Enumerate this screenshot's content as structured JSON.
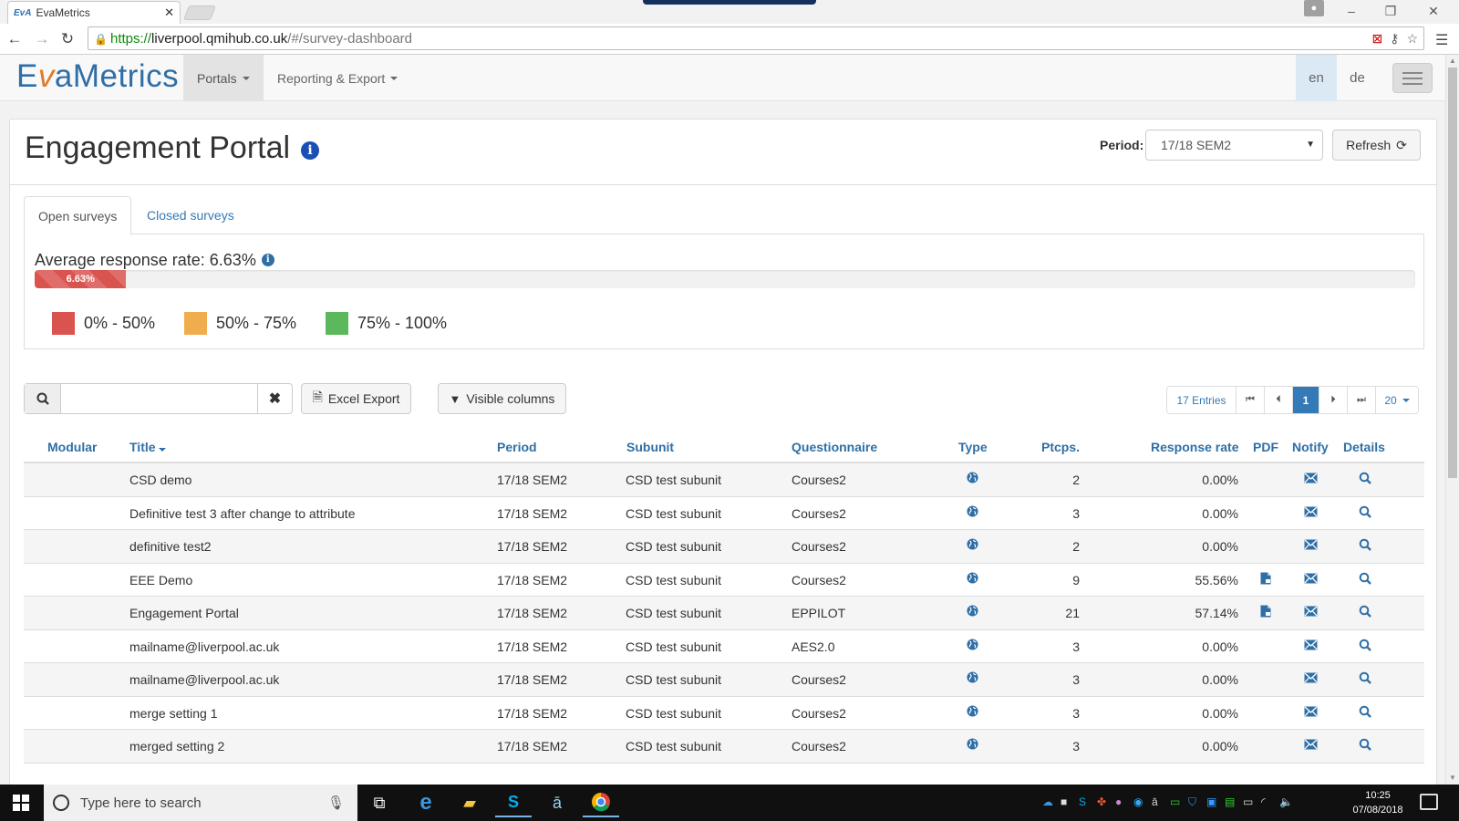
{
  "browser": {
    "tab_title": "EvaMetrics",
    "tab_favicon": "EvA",
    "url_scheme": "https://",
    "url_host": "liverpool.qmihub.co.uk",
    "url_path": "/#/survey-dashboard"
  },
  "app": {
    "logo_e": "E",
    "logo_v": "v",
    "logo_rest": "aMetrics",
    "nav": [
      {
        "label": "Portals"
      },
      {
        "label": "Reporting & Export"
      }
    ],
    "languages": [
      "en",
      "de"
    ]
  },
  "header": {
    "title": "Engagement Portal",
    "period_label": "Period:",
    "period_value": "17/18 SEM2",
    "refresh_label": "Refresh"
  },
  "tabs": [
    {
      "label": "Open surveys",
      "active": true
    },
    {
      "label": "Closed surveys",
      "active": false
    }
  ],
  "response": {
    "average_text": "Average response rate: 6.63%",
    "progress_label": "6.63%",
    "progress_fraction": 0.0663,
    "legend": [
      {
        "label": "0% - 50%",
        "color": "#d9534f"
      },
      {
        "label": "50% - 75%",
        "color": "#f0ad4e"
      },
      {
        "label": "75% - 100%",
        "color": "#5cb85c"
      }
    ]
  },
  "toolbar": {
    "search_value": "",
    "excel_label": "Excel Export",
    "columns_label": "Visible columns",
    "entries": "17 Entries",
    "current_page": "1",
    "page_size": "20"
  },
  "table": {
    "headers": [
      "Modular",
      "Title",
      "Period",
      "Subunit",
      "Questionnaire",
      "Type",
      "Ptcps.",
      "Response rate",
      "PDF",
      "Notify",
      "Details"
    ],
    "rows": [
      {
        "title": "CSD demo",
        "period": "17/18 SEM2",
        "subunit": "CSD test subunit",
        "questionnaire": "Courses2",
        "ptcps": "2",
        "rate": "0.00%",
        "pdf": false
      },
      {
        "title": "Definitive test 3 after change to attribute",
        "period": "17/18 SEM2",
        "subunit": "CSD test subunit",
        "questionnaire": "Courses2",
        "ptcps": "3",
        "rate": "0.00%",
        "pdf": false
      },
      {
        "title": "definitive test2",
        "period": "17/18 SEM2",
        "subunit": "CSD test subunit",
        "questionnaire": "Courses2",
        "ptcps": "2",
        "rate": "0.00%",
        "pdf": false
      },
      {
        "title": "EEE Demo",
        "period": "17/18 SEM2",
        "subunit": "CSD test subunit",
        "questionnaire": "Courses2",
        "ptcps": "9",
        "rate": "55.56%",
        "pdf": true
      },
      {
        "title": "Engagement Portal",
        "period": "17/18 SEM2",
        "subunit": "CSD test subunit",
        "questionnaire": "EPPILOT",
        "ptcps": "21",
        "rate": "57.14%",
        "pdf": true
      },
      {
        "title": "mailname@liverpool.ac.uk",
        "period": "17/18 SEM2",
        "subunit": "CSD test subunit",
        "questionnaire": "AES2.0",
        "ptcps": "3",
        "rate": "0.00%",
        "pdf": false
      },
      {
        "title": "mailname@liverpool.ac.uk",
        "period": "17/18 SEM2",
        "subunit": "CSD test subunit",
        "questionnaire": "Courses2",
        "ptcps": "3",
        "rate": "0.00%",
        "pdf": false
      },
      {
        "title": "merge setting 1",
        "period": "17/18 SEM2",
        "subunit": "CSD test subunit",
        "questionnaire": "Courses2",
        "ptcps": "3",
        "rate": "0.00%",
        "pdf": false
      },
      {
        "title": "merged setting 2",
        "period": "17/18 SEM2",
        "subunit": "CSD test subunit",
        "questionnaire": "Courses2",
        "ptcps": "3",
        "rate": "0.00%",
        "pdf": false
      }
    ]
  },
  "taskbar": {
    "search_placeholder": "Type here to search",
    "time": "10:25",
    "date": "07/08/2018"
  }
}
